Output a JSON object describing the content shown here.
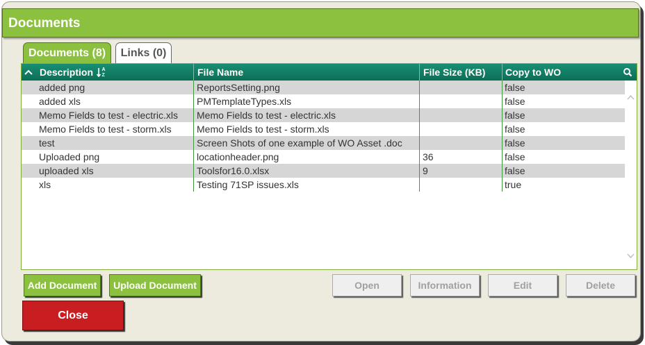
{
  "dialog": {
    "title": "Documents"
  },
  "tabs": [
    {
      "label": "Documents (8)",
      "active": true
    },
    {
      "label": "Links (0)",
      "active": false
    }
  ],
  "grid": {
    "columns": [
      "Description",
      "File Name",
      "File Size (KB)",
      "Copy to WO"
    ],
    "sort_column": "Description",
    "rows": [
      [
        "added png",
        "ReportsSetting.png",
        "",
        "false"
      ],
      [
        "added xls",
        "PMTemplateTypes.xls",
        "",
        "false"
      ],
      [
        "Memo Fields to test - electric.xls",
        "Memo Fields to test - electric.xls",
        "",
        "false"
      ],
      [
        "Memo Fields to test - storm.xls",
        "Memo Fields to test - storm.xls",
        "",
        "false"
      ],
      [
        "test",
        "Screen Shots of one example of WO Asset .doc",
        "",
        "false"
      ],
      [
        "Uploaded png",
        "locationheader.png",
        "36",
        "false"
      ],
      [
        "uploaded xls",
        "Toolsfor16.0.xlsx",
        "9",
        "false"
      ],
      [
        "xls",
        "Testing 71SP issues.xls",
        "",
        "true"
      ]
    ]
  },
  "buttons": {
    "add": "Add Document",
    "upload": "Upload Document",
    "open": "Open",
    "information": "Information",
    "edit": "Edit",
    "delete": "Delete",
    "close": "Close"
  },
  "colors": {
    "title_bar": "#8cc13f",
    "grid_header": "#117d63",
    "close_button": "#c81e22",
    "row_alt": "#d6d6d6"
  },
  "icons": [
    "collapse-up-icon",
    "sort-az-icon",
    "search-icon",
    "scroll-up-icon",
    "scroll-down-icon"
  ]
}
